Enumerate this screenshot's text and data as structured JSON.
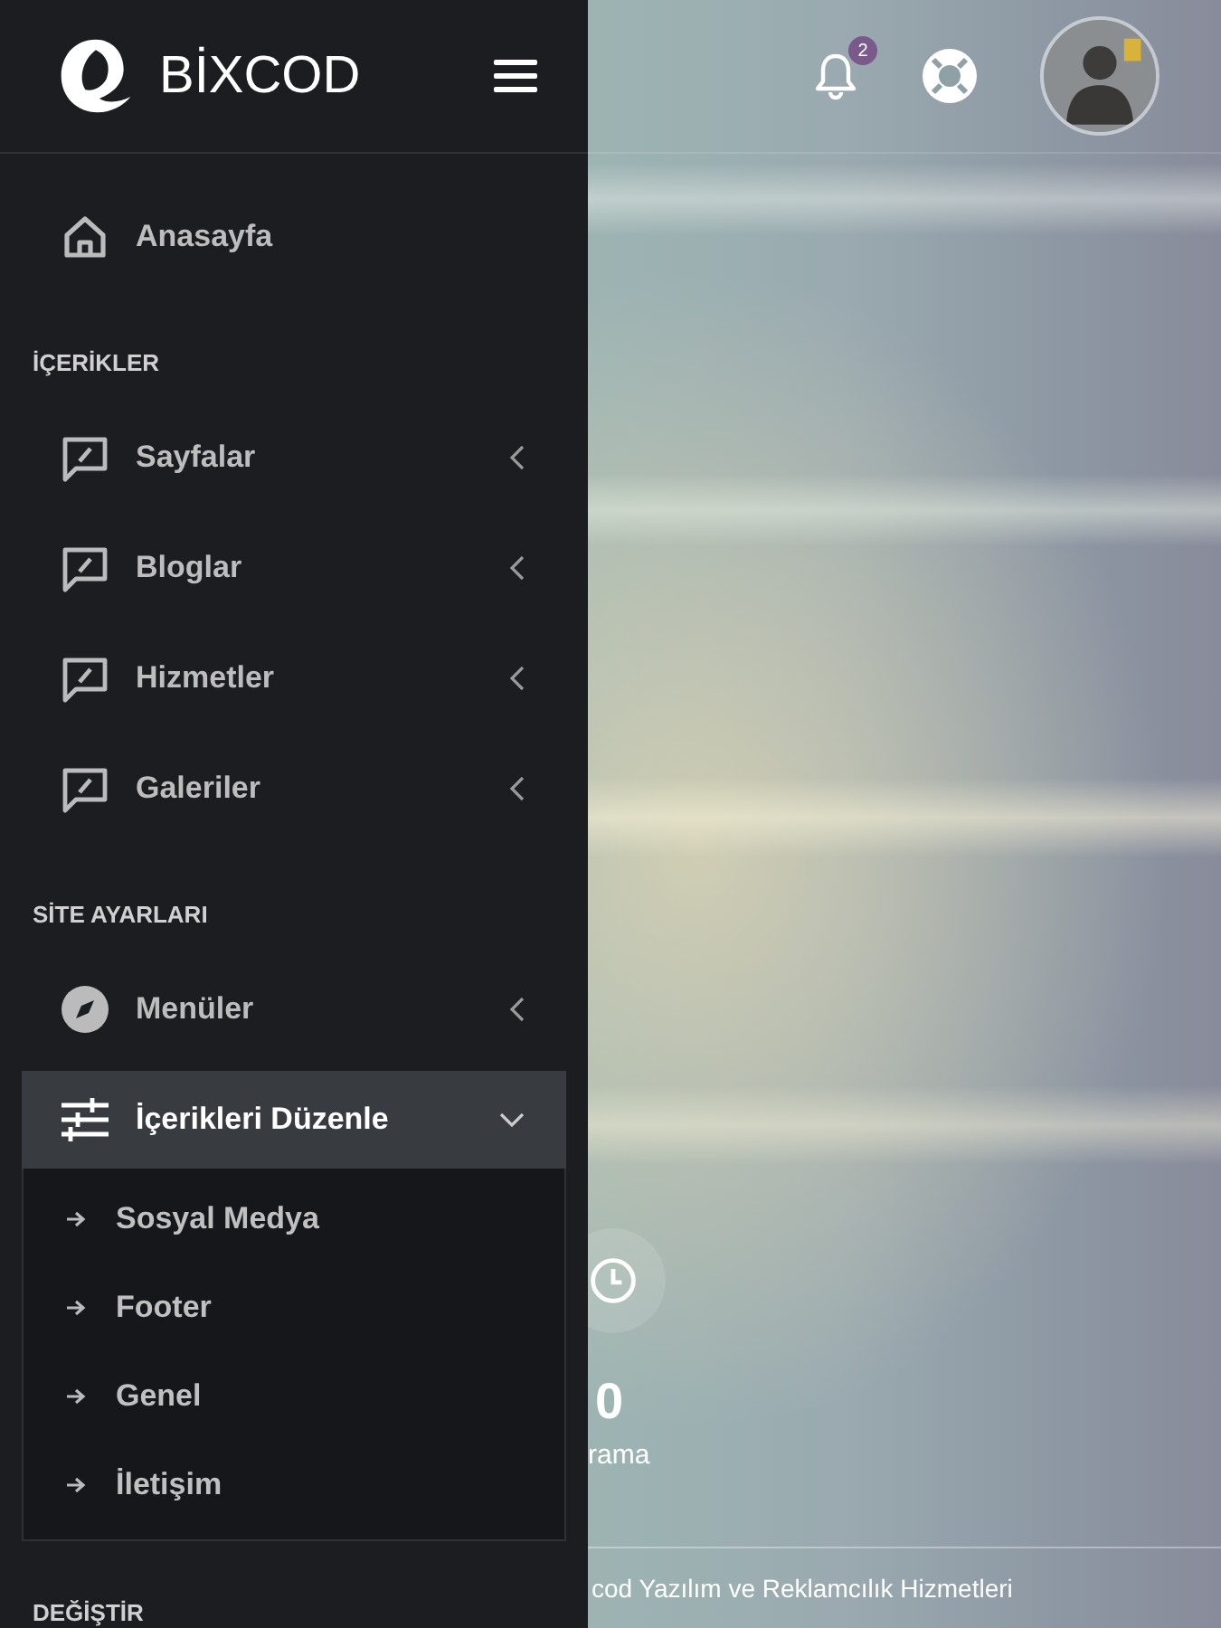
{
  "brand": {
    "name": "BİXCOD"
  },
  "header": {
    "notification_count": "2"
  },
  "sidebar": {
    "items": [
      {
        "kind": "home",
        "label": "Anasayfa",
        "selected": false
      },
      {
        "kind": "heading",
        "label": "İÇERİKLER"
      },
      {
        "kind": "content",
        "label": "Sayfalar",
        "selected": false,
        "expanded": false
      },
      {
        "kind": "content",
        "label": "Bloglar",
        "selected": false,
        "expanded": false
      },
      {
        "kind": "content",
        "label": "Hizmetler",
        "selected": false,
        "expanded": false
      },
      {
        "kind": "content",
        "label": "Galeriler",
        "selected": false,
        "expanded": false
      },
      {
        "kind": "heading",
        "label": "SİTE AYARLARI"
      },
      {
        "kind": "compass",
        "label": "Menüler",
        "selected": false,
        "expanded": false
      },
      {
        "kind": "sliders",
        "label": "İçerikleri Düzenle",
        "selected": true,
        "expanded": true,
        "children": [
          {
            "label": "Sosyal Medya",
            "selected": false
          },
          {
            "label": "Footer",
            "selected": false
          },
          {
            "label": "Genel",
            "selected": false
          },
          {
            "label": "İletişim",
            "selected": false
          }
        ]
      },
      {
        "kind": "heading",
        "label": "DEĞİŞTİR"
      }
    ]
  },
  "stat": {
    "value": "0",
    "label": "rama"
  },
  "footer": {
    "text": "cod Yazılım ve Reklamcılık Hizmetleri"
  }
}
